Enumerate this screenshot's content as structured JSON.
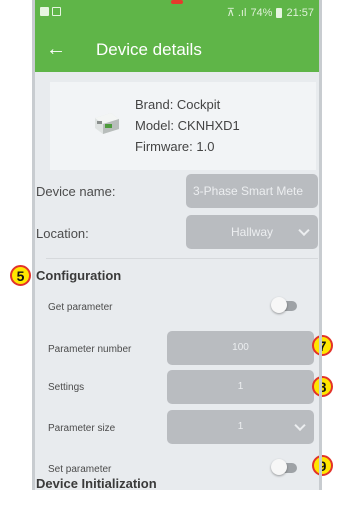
{
  "status_bar": {
    "signal_text": "⊼ .ıl",
    "battery": "74%",
    "time": "21:57"
  },
  "app_bar": {
    "back_icon": "arrow-left-icon",
    "title": "Device details"
  },
  "device": {
    "brand": "Brand: Cockpit",
    "model": "Model: CKNHXD1",
    "firmware": "Firmware: 1.0"
  },
  "device_name": {
    "label": "Device name:",
    "value": "3-Phase Smart Mete"
  },
  "location": {
    "label": "Location:",
    "value": "Hallway"
  },
  "configuration": {
    "title": "Configuration",
    "get_parameter": {
      "label": "Get parameter",
      "on": false
    },
    "parameter_number": {
      "label": "Parameter number",
      "value": "100"
    },
    "settings": {
      "label": "Settings",
      "value": "1"
    },
    "parameter_size": {
      "label": "Parameter size",
      "value": "1"
    },
    "set_parameter": {
      "label": "Set parameter",
      "on": false
    }
  },
  "device_initialization": {
    "title": "Device Initialization"
  },
  "annotations": {
    "b5": "5",
    "b7": "7",
    "b8": "8",
    "b9": "9"
  },
  "colors": {
    "accent": "#5fb548",
    "badge_fill": "#ffe600",
    "badge_border": "#e2322a",
    "pill": "#b9bcc0"
  }
}
